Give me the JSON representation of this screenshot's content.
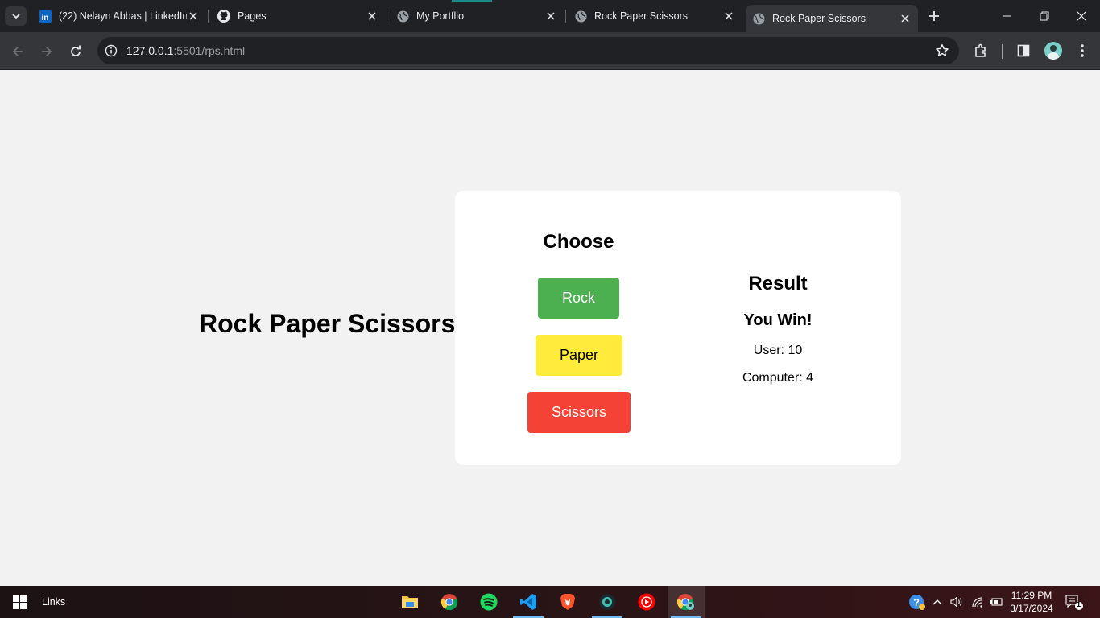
{
  "browser": {
    "tabs": [
      {
        "title": "(22) Nelayn Abbas | LinkedIn",
        "icon": "linkedin-icon"
      },
      {
        "title": "Pages",
        "icon": "github-icon"
      },
      {
        "title": "My Portflio",
        "icon": "globe-icon"
      },
      {
        "title": "Rock Paper Scissors",
        "icon": "globe-icon"
      },
      {
        "title": "Rock Paper Scissors",
        "icon": "globe-icon",
        "active": true
      }
    ],
    "url_host": "127.0.0.1",
    "url_path": ":5501/rps.html"
  },
  "page": {
    "heading": "Rock Paper Scissors",
    "choose_title": "Choose",
    "buttons": {
      "rock": "Rock",
      "paper": "Paper",
      "scissors": "Scissors"
    },
    "result_title": "Result",
    "result_message": "You Win!",
    "user_score": "User: 10",
    "computer_score": "Computer: 4"
  },
  "colors": {
    "rock": "#4caf50",
    "paper": "#ffeb3b",
    "scissors": "#f44336",
    "page_bg": "#f2f2f2"
  },
  "taskbar": {
    "label": "Links",
    "time": "11:29 PM",
    "date": "3/17/2024",
    "notification_count": "1"
  }
}
